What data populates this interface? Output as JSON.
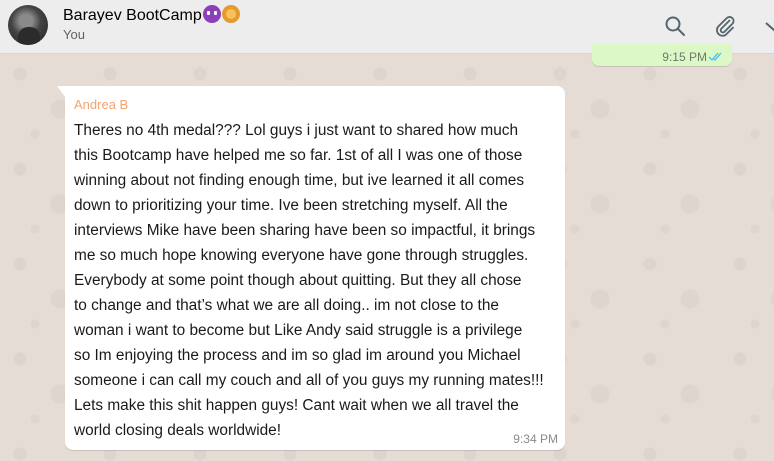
{
  "header": {
    "chat_title": "Barayev BootCamp",
    "subtitle": "You",
    "title_emojis": [
      "smiling-devil-emoji",
      "lion-emoji"
    ],
    "icons": [
      "search-icon",
      "paperclip-icon",
      "menu-icon"
    ]
  },
  "outgoing_message": {
    "time": "9:15 PM",
    "status": "read-double-check"
  },
  "incoming_message": {
    "sender": "Andrea B",
    "time": "9:34 PM",
    "lines": [
      "Theres no 4th medal??? Lol guys i just want to shared how much",
      "this Bootcamp have helped me so far. 1st of all I was one of those",
      "winning about not finding enough time, but ive learned it all comes",
      "down to prioritizing your time. Ive been stretching myself. All the",
      "interviews Mike have been sharing have been so impactful, it brings",
      "me so much hope knowing everyone have gone through struggles.",
      "Everybody at some point though about quitting. But they all chose",
      "to change and that’s what we are all doing.. im not close to the",
      "woman i want to become but Like Andy said struggle is a privilege",
      "so Im enjoying the process and im so glad im around you Michael",
      "someone i can call my couch and all of you guys my running mates!!!",
      "Lets make this shit happen guys! Cant wait when we all travel the",
      "world closing deals worldwide!"
    ]
  },
  "colors": {
    "header_bg": "#ededed",
    "wallpaper": "#e5ddd5",
    "outgoing_bubble": "#dcf8c6",
    "incoming_bubble": "#ffffff",
    "sender_name": "#f3a36f",
    "read_ticks": "#4fc3f7"
  }
}
